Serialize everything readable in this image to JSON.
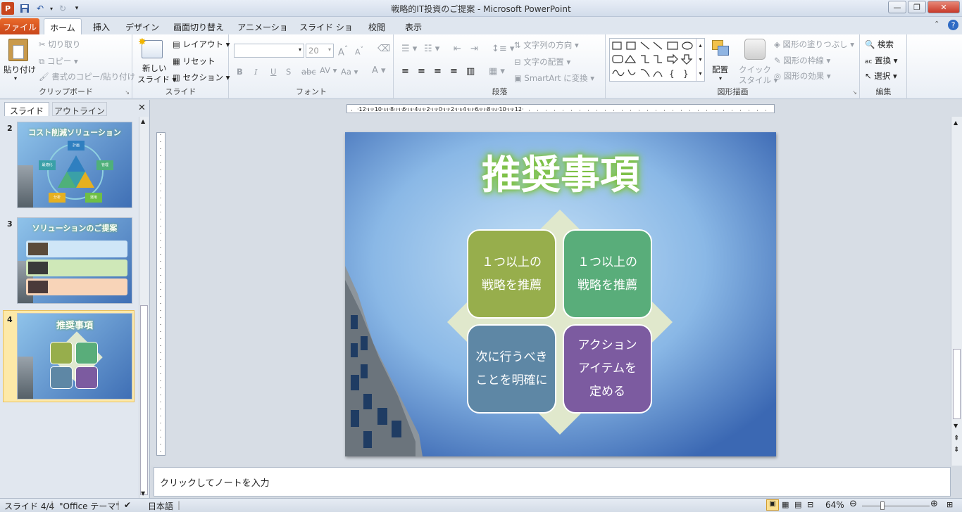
{
  "window": {
    "title": "戦略的IT投資のご提案 - Microsoft PowerPoint"
  },
  "tabs": [
    "ファイル",
    "ホーム",
    "挿入",
    "デザイン",
    "画面切り替え",
    "アニメーション",
    "スライド ショー",
    "校閲",
    "表示"
  ],
  "ribbon": {
    "clipboard": {
      "paste": "貼り付け",
      "cut": "切り取り",
      "copy": "コピー",
      "format_painter": "書式のコピー/貼り付け",
      "group": "クリップボード"
    },
    "slides": {
      "new_slide_1": "新しい",
      "new_slide_2": "スライド",
      "layout": "レイアウト",
      "reset": "リセット",
      "section": "セクション",
      "group": "スライド"
    },
    "font": {
      "size": "20",
      "group": "フォント",
      "bold": "B",
      "italic": "I",
      "underline": "U",
      "shadow": "S",
      "strike": "abc",
      "spacing": "AV",
      "case": "Aa",
      "color": "A"
    },
    "paragraph": {
      "text_direction": "文字列の方向",
      "align_text": "文字の配置",
      "smartart": "SmartArt に変換",
      "group": "段落"
    },
    "drawing": {
      "arrange": "配置",
      "quick_styles_1": "クイック",
      "quick_styles_2": "スタイル",
      "fill": "図形の塗りつぶし",
      "outline": "図形の枠線",
      "effects": "図形の効果",
      "group": "図形描画"
    },
    "editing": {
      "find": "検索",
      "replace": "置換",
      "select": "選択",
      "group": "編集"
    }
  },
  "leftpane": {
    "tab_slides": "スライド",
    "tab_outline": "アウトライン",
    "thumbs": [
      {
        "num": "2",
        "title": "コスト削減ソリューション",
        "labels": [
          "計画",
          "最適化",
          "管理",
          "分析",
          "運用"
        ]
      },
      {
        "num": "3",
        "title": "ソリューションのご提案"
      },
      {
        "num": "4",
        "title": "推奨事項"
      }
    ]
  },
  "slide": {
    "title": "推奨事項",
    "boxes": [
      {
        "line1": "１つ以上の",
        "line2": "戦略を推薦",
        "color": "#97ae4c"
      },
      {
        "line1": "１つ以上の",
        "line2": "戦略を推薦",
        "color": "#59ad7a"
      },
      {
        "line1": "次に行うべき",
        "line2": "ことを明確に",
        "color": "#5e87a5"
      },
      {
        "line1": "アクション",
        "line2": "アイテムを",
        "line3": "定める",
        "color": "#7c5ba0"
      }
    ]
  },
  "notes": {
    "placeholder": "クリックしてノートを入力"
  },
  "status": {
    "slide": "スライド 4/4",
    "theme": "\"Office テーマ\"",
    "language": "日本語",
    "zoom": "64%"
  }
}
